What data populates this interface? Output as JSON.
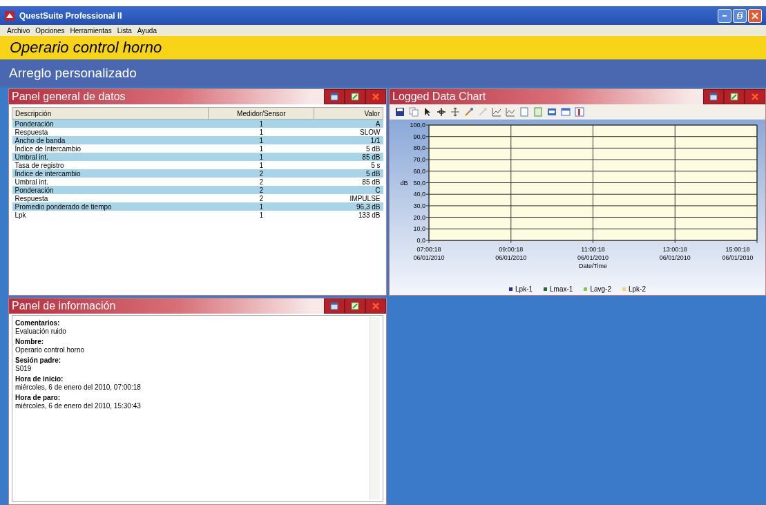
{
  "window": {
    "title": "QuestSuite Professional II"
  },
  "menu": [
    "Archivo",
    "Opciones",
    "Herramientas",
    "Lista",
    "Ayuda"
  ],
  "session_title": "Operario control horno",
  "layout_title": "Arreglo personalizado",
  "data_panel": {
    "title": "Panel general de datos",
    "columns": [
      "Descripción",
      "Medidor/Sensor",
      "Valor"
    ],
    "rows": [
      {
        "cells": [
          "Ponderación",
          "1",
          "A"
        ]
      },
      {
        "cells": [
          "Respuesta",
          "1",
          "SLOW"
        ]
      },
      {
        "cells": [
          "Ancho de banda",
          "1",
          "1/1"
        ]
      },
      {
        "cells": [
          "Índice de Intercambio",
          "1",
          "5 dB"
        ]
      },
      {
        "cells": [
          "Umbral int.",
          "1",
          "85 dB"
        ]
      },
      {
        "cells": [
          "Tasa de registro",
          "1",
          "5 s"
        ]
      },
      {
        "cells": [
          "Índice de intercambio",
          "2",
          "5 dB"
        ]
      },
      {
        "cells": [
          "Umbral int.",
          "2",
          "85 dB"
        ]
      },
      {
        "cells": [
          "Ponderación",
          "2",
          "C"
        ]
      },
      {
        "cells": [
          "Respuesta",
          "2",
          "IMPULSE"
        ]
      },
      {
        "cells": [
          "Promedio ponderado de tiempo",
          "1",
          "96,3 dB"
        ]
      },
      {
        "cells": [
          "Lpk",
          "1",
          "133   dB"
        ]
      }
    ]
  },
  "chart_panel": {
    "title": "Logged Data Chart",
    "chart_data": {
      "type": "line",
      "xlabel": "Date/Time",
      "ylabel": "dB",
      "ylim": [
        0,
        100
      ],
      "grid": true,
      "yticks": [
        {
          "value": 0,
          "label": "0,0"
        },
        {
          "value": 10,
          "label": "10,0"
        },
        {
          "value": 20,
          "label": "20,0"
        },
        {
          "value": 30,
          "label": "30,0"
        },
        {
          "value": 40,
          "label": "40,0"
        },
        {
          "value": 50,
          "label": "50,0"
        },
        {
          "value": 60,
          "label": "60,0"
        },
        {
          "value": 70,
          "label": "70,0"
        },
        {
          "value": 80,
          "label": "80,0"
        },
        {
          "value": 90,
          "label": "90,0"
        },
        {
          "value": 100,
          "label": "100,0"
        }
      ],
      "categories": [
        "07:00:18\n06/01/2010",
        "09:00:18\n06/01/2010",
        "11:00:18\n06/01/2010",
        "13:00:18\n06/01/2010",
        "15:00:18\n06/01/2010"
      ],
      "series": [
        {
          "name": "Lpk-1",
          "color": "#2a2a9a",
          "values": [
            null,
            null,
            null,
            null,
            null
          ]
        },
        {
          "name": "Lmax-1",
          "color": "#1e6b2e",
          "values": [
            null,
            null,
            null,
            null,
            null
          ]
        },
        {
          "name": "Lavg-2",
          "color": "#7ccf4a",
          "values": [
            null,
            null,
            null,
            null,
            null
          ]
        },
        {
          "name": "Lpk-2",
          "color": "#f0d870",
          "values": [
            null,
            null,
            null,
            null,
            null
          ]
        }
      ]
    }
  },
  "info_panel": {
    "title": "Panel de información",
    "fields": [
      {
        "label": "Comentarios:",
        "value": "Evaluación ruido"
      },
      {
        "label": "Nombre:",
        "value": "Operario control horno"
      },
      {
        "label": "Sesión padre:",
        "value": "S019"
      },
      {
        "label": "Hora de inicio:",
        "value": "miércoles, 6 de enero del 2010, 07:00:18"
      },
      {
        "label": "Hora de paro:",
        "value": "miércoles, 6 de enero del 2010, 15:30:43"
      }
    ]
  }
}
